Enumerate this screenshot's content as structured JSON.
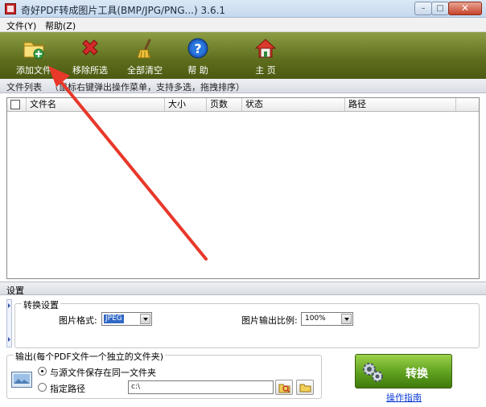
{
  "window": {
    "title": "奇好PDF转成图片工具(BMP/JPG/PNG...) 3.6.1",
    "minimize_glyph": "–",
    "maximize_glyph": "□",
    "close_glyph": "✕"
  },
  "menu": {
    "items": [
      {
        "label": "文件(Y)"
      },
      {
        "label": "帮助(Z)"
      }
    ]
  },
  "toolbar": {
    "buttons": [
      {
        "label": "添加文件",
        "icon": "folder-add-icon"
      },
      {
        "label": "移除所选",
        "icon": "red-x-icon"
      },
      {
        "label": "全部清空",
        "icon": "broom-icon"
      },
      {
        "label": "帮 助",
        "icon": "help-icon"
      },
      {
        "label": "主 页",
        "icon": "home-icon"
      }
    ]
  },
  "file_list": {
    "title": "文件列表",
    "hint": "（鼠标右键弹出操作菜单，支持多选，拖拽排序）",
    "columns": [
      "文件名",
      "大小",
      "页数",
      "状态",
      "路径"
    ],
    "rows": []
  },
  "settings": {
    "title": "设置",
    "convert_group": {
      "title": "转换设置",
      "format_label": "图片格式:",
      "format_value": "JPEG",
      "scale_label": "图片输出比例:",
      "scale_value": "100%"
    },
    "output_group": {
      "title": "输出(每个PDF文件一个独立的文件夹)",
      "option_same_folder": "与源文件保存在同一文件夹",
      "option_custom_path": "指定路径",
      "selected_option": "same_folder",
      "path_value": "c:\\"
    }
  },
  "actions": {
    "convert_label": "转换",
    "guide_link": "操作指南"
  },
  "colors": {
    "toolbar": "#6b7a26",
    "arrow": "#e8382a",
    "convert": "#5ea01f",
    "link": "#0a3ad6"
  }
}
